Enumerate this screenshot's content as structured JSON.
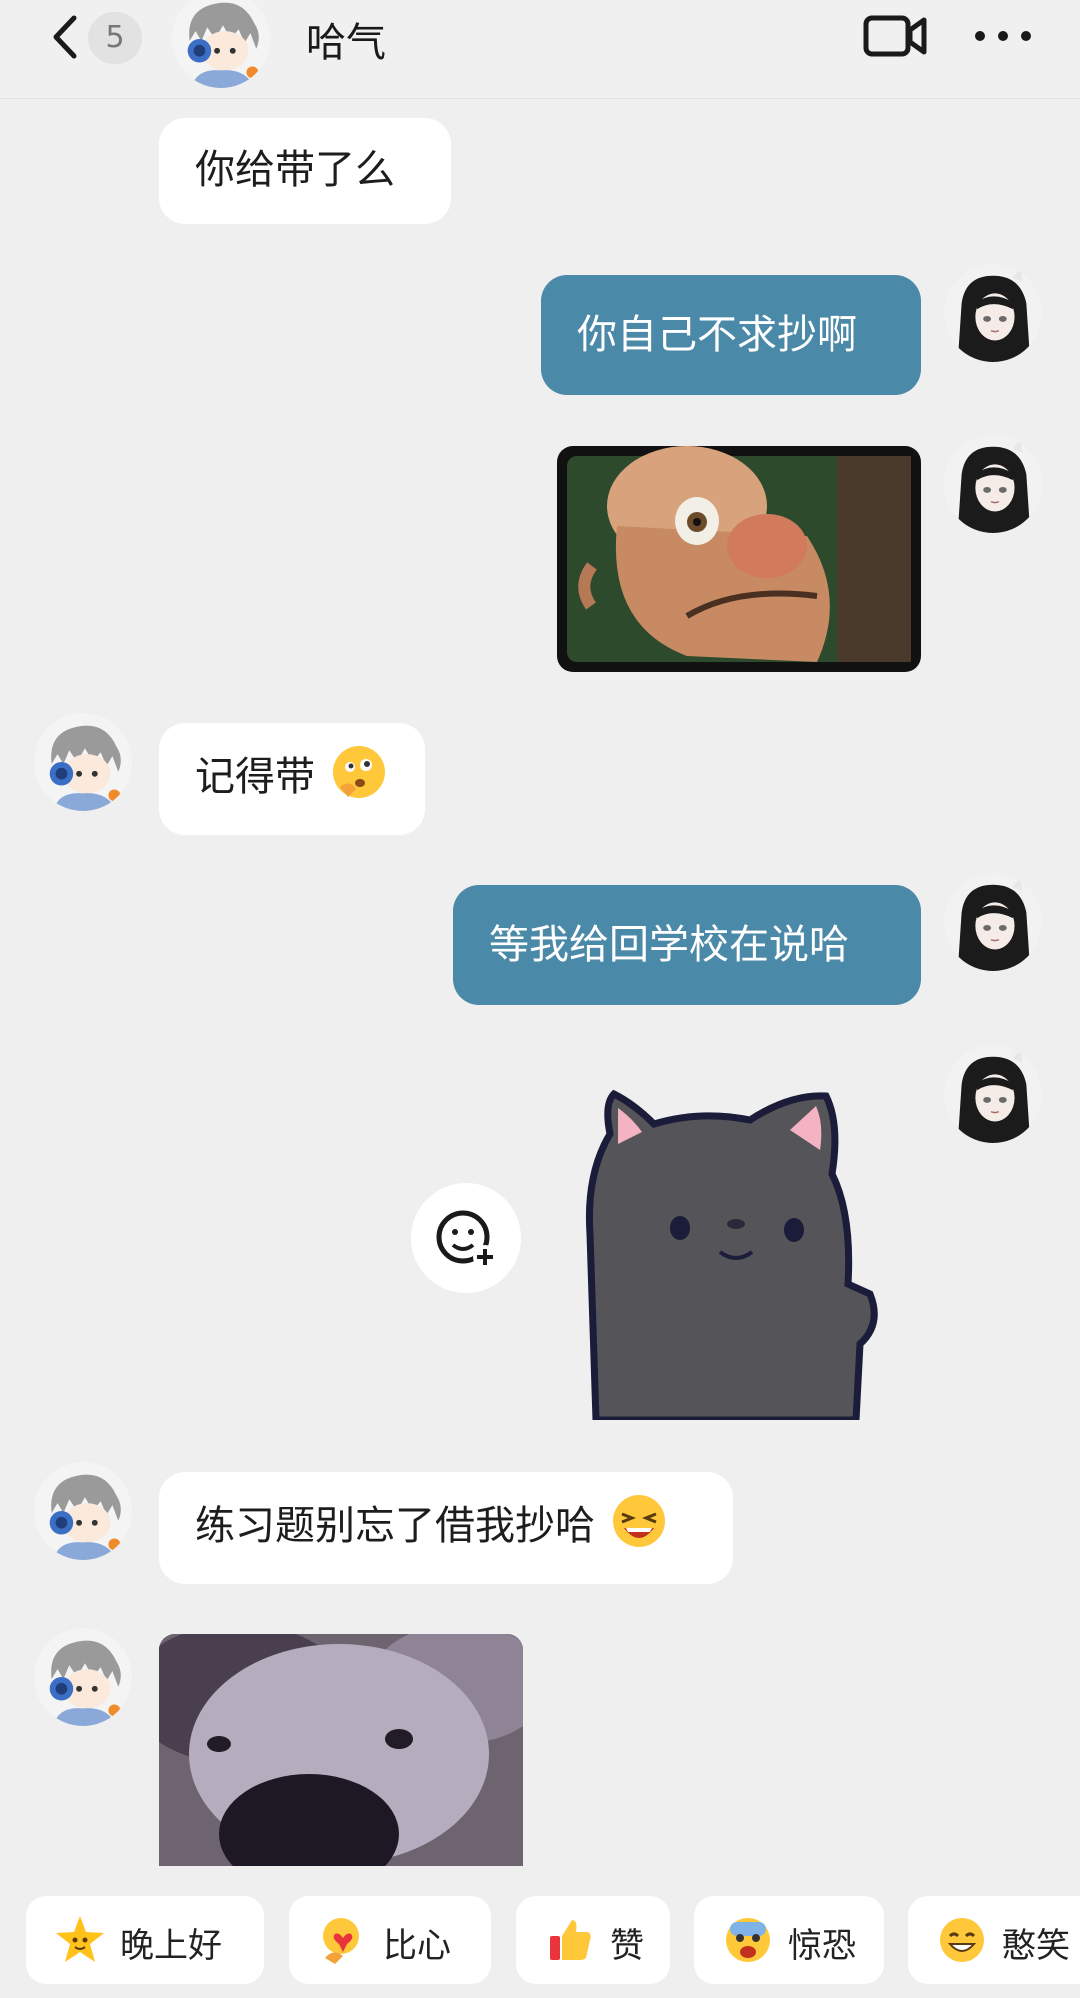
{
  "header": {
    "unread_count": "5",
    "contact_name": "哈气",
    "back_icon": "chevron-left-icon",
    "video_icon": "video-call-icon",
    "more_icon": "more-dots-icon"
  },
  "messages": [
    {
      "side": "left",
      "type": "text",
      "text": "你给带了么"
    },
    {
      "side": "right",
      "type": "text",
      "text": "你自己不求抄啊"
    },
    {
      "side": "right",
      "type": "image",
      "content": "cartoon-bald-man-meme"
    },
    {
      "side": "left",
      "type": "text",
      "text": "记得带",
      "emoji": "thinking-emoji"
    },
    {
      "side": "right",
      "type": "text",
      "text": "等我给回学校在说哈"
    },
    {
      "side": "right",
      "type": "sticker",
      "content": "gray-cat-sticker"
    },
    {
      "side": "left",
      "type": "text",
      "text": "练习题别忘了借我抄哈",
      "emoji": "laughing-emoji"
    },
    {
      "side": "left",
      "type": "image",
      "content": "dog-closeup-meme"
    }
  ],
  "add_sticker_icon": "add-emoji-icon",
  "quick_replies": [
    {
      "label": "晚上好",
      "icon": "star-emoji-icon"
    },
    {
      "label": "比心",
      "icon": "heart-hands-emoji-icon"
    },
    {
      "label": "赞",
      "icon": "thumbs-up-emoji-icon"
    },
    {
      "label": "惊恐",
      "icon": "scared-emoji-icon"
    },
    {
      "label": "憨笑",
      "icon": "grin-emoji-icon"
    }
  ],
  "colors": {
    "background": "#efefef",
    "sent_bubble": "#4b89a8",
    "received_bubble": "#ffffff"
  }
}
